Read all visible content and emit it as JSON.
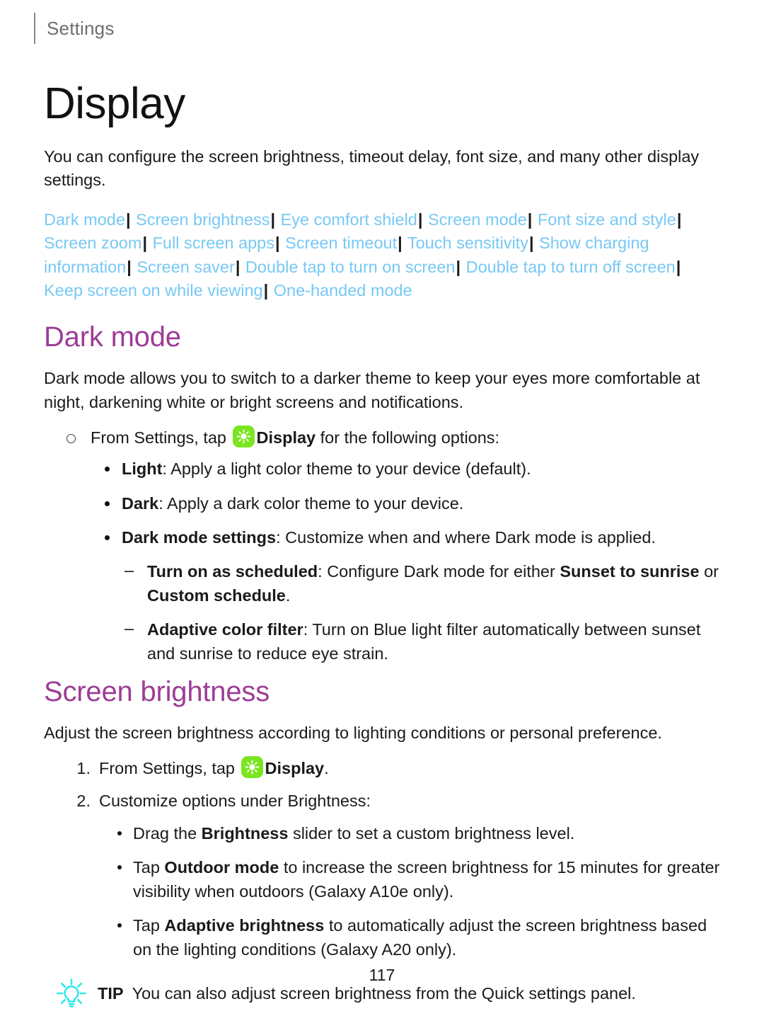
{
  "header": {
    "running_title": "Settings"
  },
  "page_title": "Display",
  "intro": "You can configure the screen brightness, timeout delay, font size, and many other display settings.",
  "link_bar": {
    "separator": "|",
    "links": [
      "Dark mode",
      "Screen brightness",
      "Eye comfort shield",
      "Screen mode",
      "Font size and style",
      "Screen zoom",
      "Full screen apps",
      "Screen timeout",
      "Touch sensitivity",
      "Show charging information",
      "Screen saver",
      "Double tap to turn on screen",
      "Double tap to turn off screen",
      "Keep screen on while viewing",
      "One-handed mode"
    ]
  },
  "sections": [
    {
      "heading": "Dark mode",
      "body": "Dark mode allows you to switch to a darker theme to keep your eyes more comfortable at night, darkening white or bright screens and notifications.",
      "step": {
        "prefix": "From Settings, tap ",
        "icon": "display-app-icon",
        "app_name": "Display",
        "suffix": " for the following options:"
      },
      "options": [
        {
          "term": "Light",
          "desc": ": Apply a light color theme to your device (default)."
        },
        {
          "term": "Dark",
          "desc": ": Apply a dark color theme to your device."
        },
        {
          "term": "Dark mode settings",
          "desc": ": Customize when and where Dark mode is applied."
        }
      ],
      "sub_options": [
        {
          "term": "Turn on as scheduled",
          "part1": ": Configure Dark mode for either ",
          "bold1": "Sunset to sunrise",
          "part2": " or ",
          "bold2": "Custom schedule",
          "part3": "."
        },
        {
          "term": "Adaptive color filter",
          "part1": ": Turn on Blue light filter automatically between sunset and sunrise to reduce eye strain.",
          "bold1": "",
          "part2": "",
          "bold2": "",
          "part3": ""
        }
      ]
    },
    {
      "heading": "Screen brightness",
      "body": "Adjust the screen brightness according to lighting conditions or personal preference.",
      "steps": [
        {
          "num": "1.",
          "prefix": "From Settings, tap ",
          "icon": "display-app-icon",
          "app_name": "Display",
          "suffix": "."
        },
        {
          "num": "2.",
          "prefix": "Customize options under Brightness:",
          "icon": "",
          "app_name": "",
          "suffix": ""
        }
      ],
      "bullets": [
        {
          "pre": "Drag the ",
          "bold": "Brightness",
          "post": " slider to set a custom brightness level."
        },
        {
          "pre": "Tap ",
          "bold": "Outdoor mode",
          "post": " to increase the screen brightness for 15 minutes for greater visibility when outdoors (Galaxy A10e only)."
        },
        {
          "pre": "Tap ",
          "bold": "Adaptive brightness",
          "post": " to automatically adjust the screen brightness based on the lighting conditions (Galaxy A20 only)."
        }
      ]
    }
  ],
  "tip": {
    "icon": "lightbulb-icon",
    "label": "TIP",
    "text": "You can also adjust screen brightness from the Quick settings panel."
  },
  "page_number": "117",
  "colors": {
    "link": "#77c8f5",
    "heading": "#9c3d97",
    "app_icon_bg": "#7ae520",
    "tip_icon": "#32e8e8",
    "running_header": "#6e6e6e"
  }
}
